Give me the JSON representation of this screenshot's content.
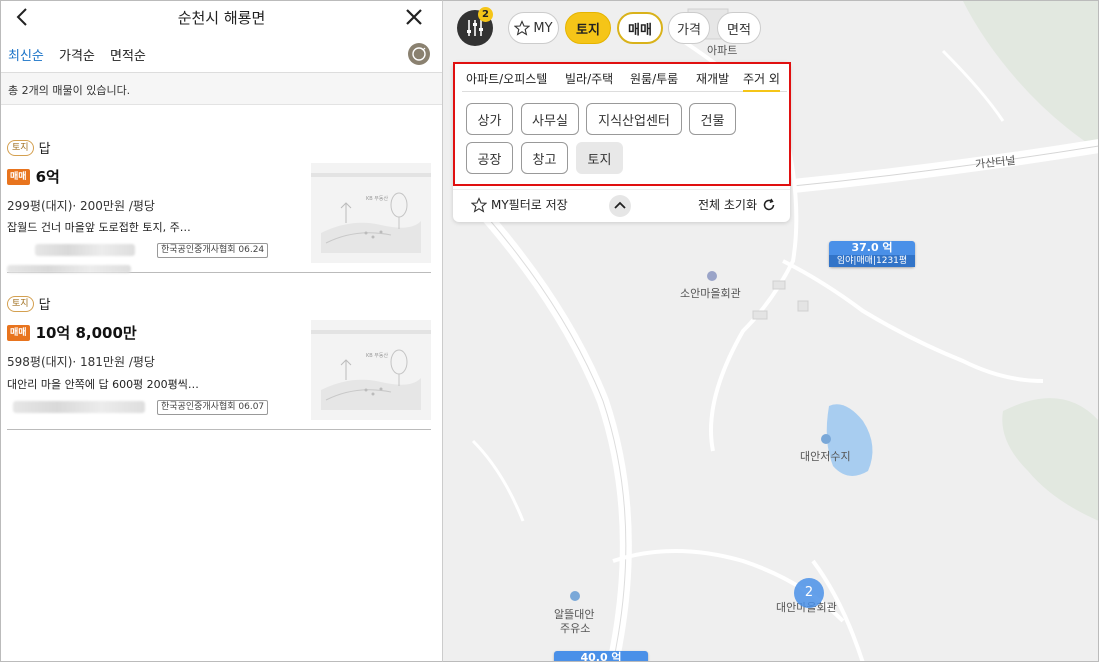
{
  "panel": {
    "title": "순천시 해룡면",
    "sort_options": [
      "최신순",
      "가격순",
      "면적순"
    ],
    "count_text": "총 2개의 매물이 있습니다.",
    "listings": [
      {
        "category_badge": "토지",
        "land_type": "답",
        "deal_badge": "매매",
        "price": "6억",
        "detail": "299평(대지)· 200만원 /평당",
        "description": "잡월드 건너 마을앞 도로접한 토지, 주…",
        "agency": "한국공인중개사협회 06.24"
      },
      {
        "category_badge": "토지",
        "land_type": "답",
        "deal_badge": "매매",
        "price": "10억 8,000만",
        "detail": "598평(대지)· 181만원 /평당",
        "description": "대안리 마을 안쪽에 답 600평 200평씩…",
        "agency": "한국공인중개사협회 06.07"
      }
    ],
    "thumb_brand": "KB 부동산"
  },
  "map": {
    "filter_count": "2",
    "chips": [
      "MY",
      "토지",
      "매매",
      "가격",
      "면적"
    ],
    "property_types": [
      "아파트/오피스텔",
      "빌라/주택",
      "원룸/투룸",
      "재개발",
      "주거 외"
    ],
    "sub_types": [
      "상가",
      "사무실",
      "지식산업센터",
      "건물",
      "공장",
      "창고",
      "토지"
    ],
    "save_my_filter": "MY필터로 저장",
    "reset_all": "전체 초기화",
    "labels": {
      "apartment": "아파트",
      "tunnel": "가산터널",
      "hall1": "소안마을회관",
      "reservoir": "대안저수지",
      "hall2": "대안마을회관",
      "gas1": "알뜰대안",
      "gas2": "주유소"
    },
    "markers": [
      {
        "price": "37.0 억",
        "sub": "임야|매매|1231평"
      },
      {
        "price": "40.0 억"
      }
    ],
    "cluster_count": "2"
  },
  "colors": {
    "accent_yellow": "#f5c518",
    "accent_blue": "#1a73c8",
    "deal_orange": "#e8741e",
    "highlight_red": "#e01010",
    "marker_blue": "#4a90e8"
  }
}
